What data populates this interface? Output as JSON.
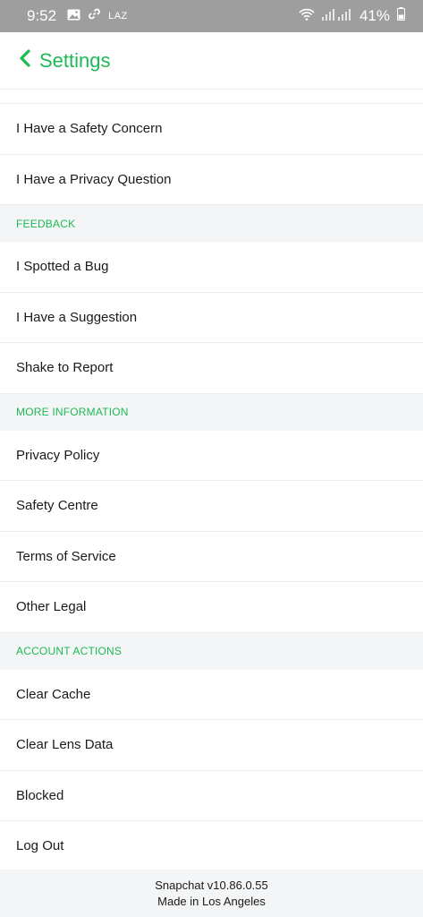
{
  "status_bar": {
    "time": "9:52",
    "carrier_text": "LAZ",
    "battery_percent": "41%",
    "icons": [
      "image-icon",
      "link-icon",
      "wifi-icon",
      "signal-icon",
      "battery-icon"
    ]
  },
  "header": {
    "back_icon": "chevron-left-icon",
    "title": "Settings",
    "accent_color": "#1db954"
  },
  "groups": [
    {
      "section": null,
      "items": [
        "I Have a Safety Concern",
        "I Have a Privacy Question"
      ]
    },
    {
      "section": "FEEDBACK",
      "items": [
        "I Spotted a Bug",
        "I Have a Suggestion",
        "Shake to Report"
      ]
    },
    {
      "section": "MORE INFORMATION",
      "items": [
        "Privacy Policy",
        "Safety Centre",
        "Terms of Service",
        "Other Legal"
      ]
    },
    {
      "section": "ACCOUNT ACTIONS",
      "items": [
        "Clear Cache",
        "Clear Lens Data",
        "Blocked",
        "Log Out"
      ]
    }
  ],
  "footer": {
    "version": "Snapchat v10.86.0.55",
    "made_in": "Made in Los Angeles"
  }
}
